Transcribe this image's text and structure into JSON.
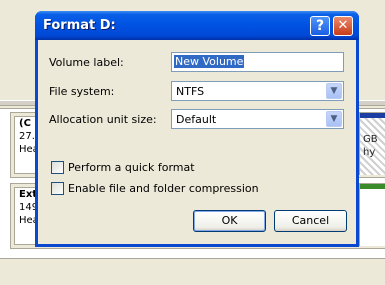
{
  "dialog": {
    "title": "Format D:",
    "help_glyph": "?",
    "close_glyph": "✕",
    "volume_label": {
      "label": "Volume label:",
      "value": "New Volume"
    },
    "file_system": {
      "label": "File system:",
      "value": "NTFS"
    },
    "allocation": {
      "label": "Allocation unit size:",
      "value": "Default"
    },
    "dropdown_glyph": "▼",
    "quick_format": {
      "label": "Perform a quick format",
      "checked": false
    },
    "compression": {
      "label": "Enable file and folder compression",
      "checked": false
    },
    "ok_label": "OK",
    "cancel_label": "Cancel"
  },
  "background": {
    "disk1": {
      "line1": "(C",
      "line2": "27.",
      "line3": "Hea"
    },
    "disk1_part": {
      "line1": "GB",
      "line2": "hy"
    },
    "disk2": {
      "line1": "Ext",
      "line2": "149",
      "line3": "Hea"
    }
  },
  "colors": {
    "titlebar": "#0054e3",
    "selection": "#316ac5",
    "primary_partition": "#1c3ea3",
    "extended_partition": "#3a8c2b"
  }
}
